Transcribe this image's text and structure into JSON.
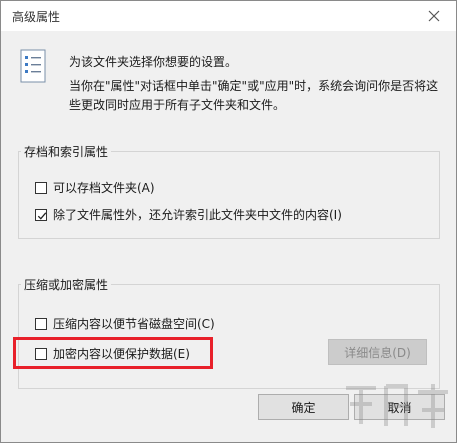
{
  "window": {
    "title": "高级属性",
    "close_icon": "close-icon"
  },
  "intro": {
    "icon": "document-checklist-icon",
    "text": "为该文件夹选择你想要的设置。",
    "description": "当你在\"属性\"对话框中单击\"确定\"或\"应用\"时，系统会询问你是否将这些更改同时应用于所有子文件夹和文件。"
  },
  "archive_group": {
    "legend": "存档和索引属性",
    "archive": {
      "label": "可以存档文件夹(A)",
      "checked": false
    },
    "index": {
      "label": "除了文件属性外，还允许索引此文件夹中文件的内容(I)",
      "checked": true
    }
  },
  "compress_group": {
    "legend": "压缩或加密属性",
    "compress": {
      "label": "压缩内容以便节省磁盘空间(C)",
      "checked": false
    },
    "encrypt": {
      "label": "加密内容以便保护数据(E)",
      "checked": false
    },
    "details_label": "详细信息(D)"
  },
  "buttons": {
    "ok_label": "确定",
    "cancel_label": "取消"
  },
  "colors": {
    "highlight": "#e8202a",
    "dialog_bg": "#f0f0f0",
    "titlebar_bg": "#ffffff"
  }
}
